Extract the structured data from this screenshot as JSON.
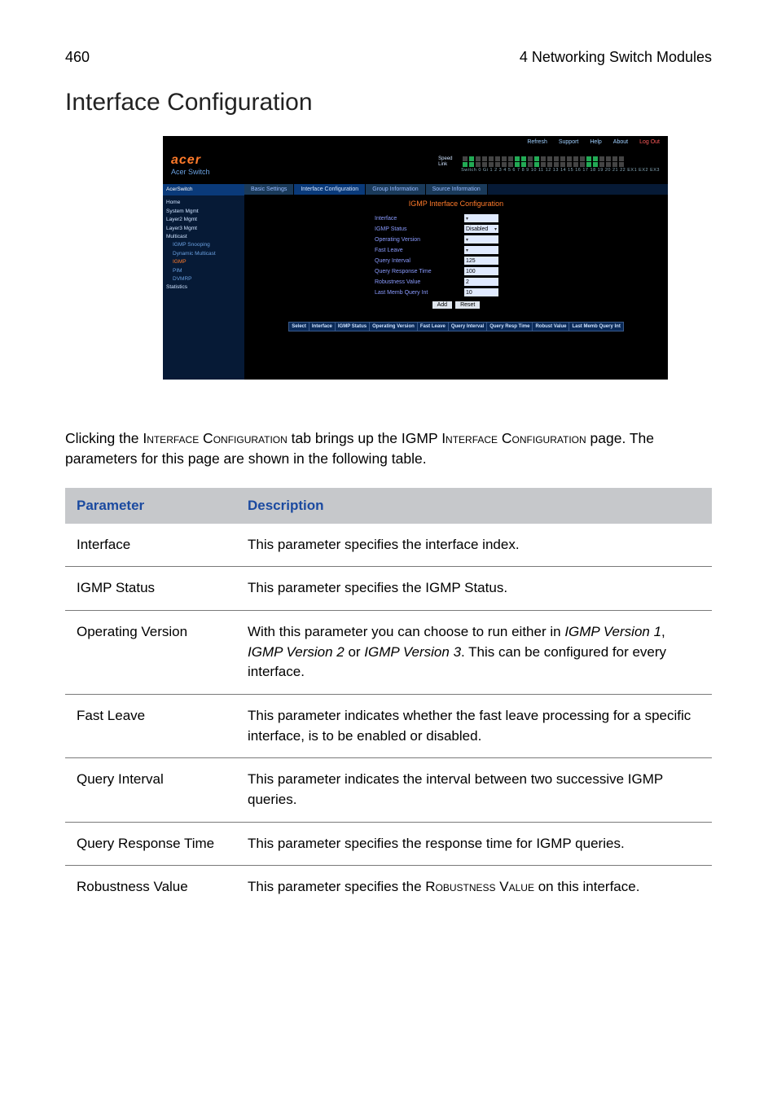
{
  "header": {
    "page_number": "460",
    "chapter": "4 Networking Switch Modules"
  },
  "section_title": "Interface Configuration",
  "screenshot": {
    "topbar": {
      "refresh": "Refresh",
      "support": "Support",
      "help": "Help",
      "about": "About",
      "logout": "Log Out"
    },
    "logo": {
      "brand": "acer",
      "sub": "Acer Switch"
    },
    "ports": {
      "speed_label": "Speed",
      "link_label": "Link",
      "numbers": "Switch 0 Gi 1 2 3 4 5 6 7 8 9 10 11 12 13 14 15 16 17 18 19 20 21 22 EX1 EX2 EX3"
    },
    "sidebar": {
      "title": "AcerSwitch",
      "items": [
        {
          "label": "Home",
          "cls": "grp"
        },
        {
          "label": "System Mgmt",
          "cls": "grp"
        },
        {
          "label": "Layer2 Mgmt",
          "cls": "grp"
        },
        {
          "label": "Layer3 Mgmt",
          "cls": "grp"
        },
        {
          "label": "Multicast",
          "cls": "grp"
        },
        {
          "label": "IGMP Snooping",
          "cls": "itm"
        },
        {
          "label": "Dynamic Multicast",
          "cls": "itm"
        },
        {
          "label": "IGMP",
          "cls": "itm act"
        },
        {
          "label": "PIM",
          "cls": "itm"
        },
        {
          "label": "DVMRP",
          "cls": "itm"
        },
        {
          "label": "Statistics",
          "cls": "grp"
        }
      ]
    },
    "tabs": [
      "Basic Settings",
      "Interface Configuration",
      "Group Information",
      "Source Information"
    ],
    "panel_title": "IGMP Interface Configuration",
    "form": {
      "rows": [
        {
          "label": "Interface",
          "value": "",
          "select": true
        },
        {
          "label": "IGMP Status",
          "value": "Disabled",
          "select": true
        },
        {
          "label": "Operating Version",
          "value": "",
          "select": true
        },
        {
          "label": "Fast Leave",
          "value": "",
          "select": true
        },
        {
          "label": "Query Interval",
          "value": "125",
          "select": false
        },
        {
          "label": "Query Response Time",
          "value": "100",
          "select": false
        },
        {
          "label": "Robustness Value",
          "value": "2",
          "select": false
        },
        {
          "label": "Last Memb Query Int",
          "value": "10",
          "select": false
        }
      ],
      "buttons": [
        "Add",
        "Reset"
      ]
    },
    "result_headers": [
      "Select",
      "Interface",
      "IGMP Status",
      "Operating Version",
      "Fast Leave",
      "Query Interval",
      "Query Resp Time",
      "Robust Value",
      "Last Memb Query Int"
    ]
  },
  "body_paragraph": {
    "pre": "Clicking the ",
    "tab_name": "Interface Configuration",
    "mid1": " tab brings up the IGMP ",
    "page_name": "Interface Configuration",
    "mid2": " page. The parameters for this page are shown in the following table."
  },
  "table": {
    "head": {
      "param": "Parameter",
      "desc": "Description"
    },
    "rows": [
      {
        "param": "Interface",
        "desc_plain": "This parameter specifies the interface index."
      },
      {
        "param": "IGMP Status",
        "desc_plain": "This parameter specifies the IGMP Status."
      },
      {
        "param": "Operating Version",
        "desc_pre": "With this parameter you can choose to run either in ",
        "it1": "IGMP Version 1",
        "sep1": ", ",
        "it2": "IGMP Version 2",
        "sep2": " or ",
        "it3": "IGMP Version 3",
        "desc_post": ". This can be configured for every interface."
      },
      {
        "param": "Fast Leave",
        "desc_plain": "This parameter indicates whether the fast leave processing for a specific interface, is to be enabled or disabled."
      },
      {
        "param": "Query Interval",
        "desc_plain": "This parameter indicates the interval between two successive IGMP queries."
      },
      {
        "param": "Query Response Time",
        "desc_plain": "This parameter specifies the response time for IGMP queries."
      },
      {
        "param": "Robustness Value",
        "desc_pre2": "This parameter specifies the ",
        "sc": "Robustness Value",
        "desc_post2": " on this interface."
      }
    ]
  }
}
